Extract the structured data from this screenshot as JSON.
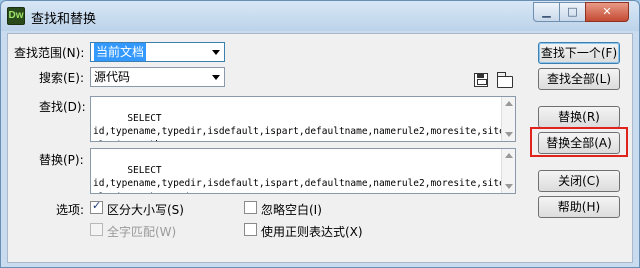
{
  "window": {
    "title": "查找和替换",
    "app_icon_text": "Dw",
    "buttons": {
      "minimize": "▁",
      "maximize": "□",
      "close": "✕"
    }
  },
  "find_scope": {
    "label": "查找范围(N):",
    "value": "当前文档"
  },
  "search_type": {
    "label": "搜索(E):",
    "value": "源代码"
  },
  "find": {
    "label": "查找(D):",
    "text": "SELECT\nid,typename,typedir,isdefault,ispart,defaultname,namerule2,moresite,siteurl,sitepath"
  },
  "replace": {
    "label": "替换(P):",
    "text": "SELECT\nid,typename,typedir,isdefault,ispart,defaultname,namerule2,moresite,siteurl,sitepath,typeimg"
  },
  "options": {
    "label": "选项:",
    "match_case": {
      "label": "区分大小写(S)",
      "checked": true
    },
    "whole_word": {
      "label": "全字匹配(W)",
      "checked": false,
      "disabled": true
    },
    "ignore_whitespace": {
      "label": "忽略空白(I)",
      "checked": false
    },
    "regex": {
      "label": "使用正则表达式(X)",
      "checked": false
    }
  },
  "actions": {
    "find_next": "查找下一个(F)",
    "find_all": "查找全部(L)",
    "replace": "替换(R)",
    "replace_all": "替换全部(A)",
    "close": "关闭(C)",
    "help": "帮助(H)"
  },
  "toolbar_icons": [
    "save-icon",
    "open-folder-icon"
  ],
  "colors": {
    "highlight_box": "#e0241b",
    "selection": "#3399ff",
    "title_bar": "#c9dcef"
  }
}
